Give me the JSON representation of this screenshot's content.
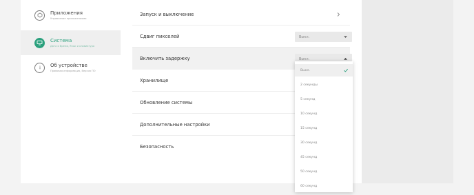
{
  "accent_color": "#2ba07d",
  "sidebar": {
    "items": [
      {
        "title": "Приложения",
        "subtitle": "Управление приложениями",
        "icon": "apps-icon"
      },
      {
        "title": "Система",
        "subtitle": "Дата и Время, Язык и клавиатура",
        "icon": "monitor-icon"
      },
      {
        "title": "Об устройстве",
        "subtitle": "Правовая информация, Версия ПО",
        "icon": "info-icon"
      }
    ],
    "active_index": 1
  },
  "settings": {
    "rows": [
      {
        "label": "Запуск и выключение"
      },
      {
        "label": "Сдвиг пикселей",
        "value": "Выкл."
      },
      {
        "label": "Включить задержку",
        "value": "Выкл."
      },
      {
        "label": "Хранилище"
      },
      {
        "label": "Обновление системы"
      },
      {
        "label": "Дополнительные настройки"
      },
      {
        "label": "Безопасность"
      }
    ]
  },
  "dropdown": {
    "options": [
      "Выкл.",
      "2 секунды",
      "5 секунд",
      "10 секунд",
      "15 секунд",
      "30 секунд",
      "45 секунд",
      "50 секунд",
      "60 секунд"
    ],
    "selected_index": 0
  }
}
